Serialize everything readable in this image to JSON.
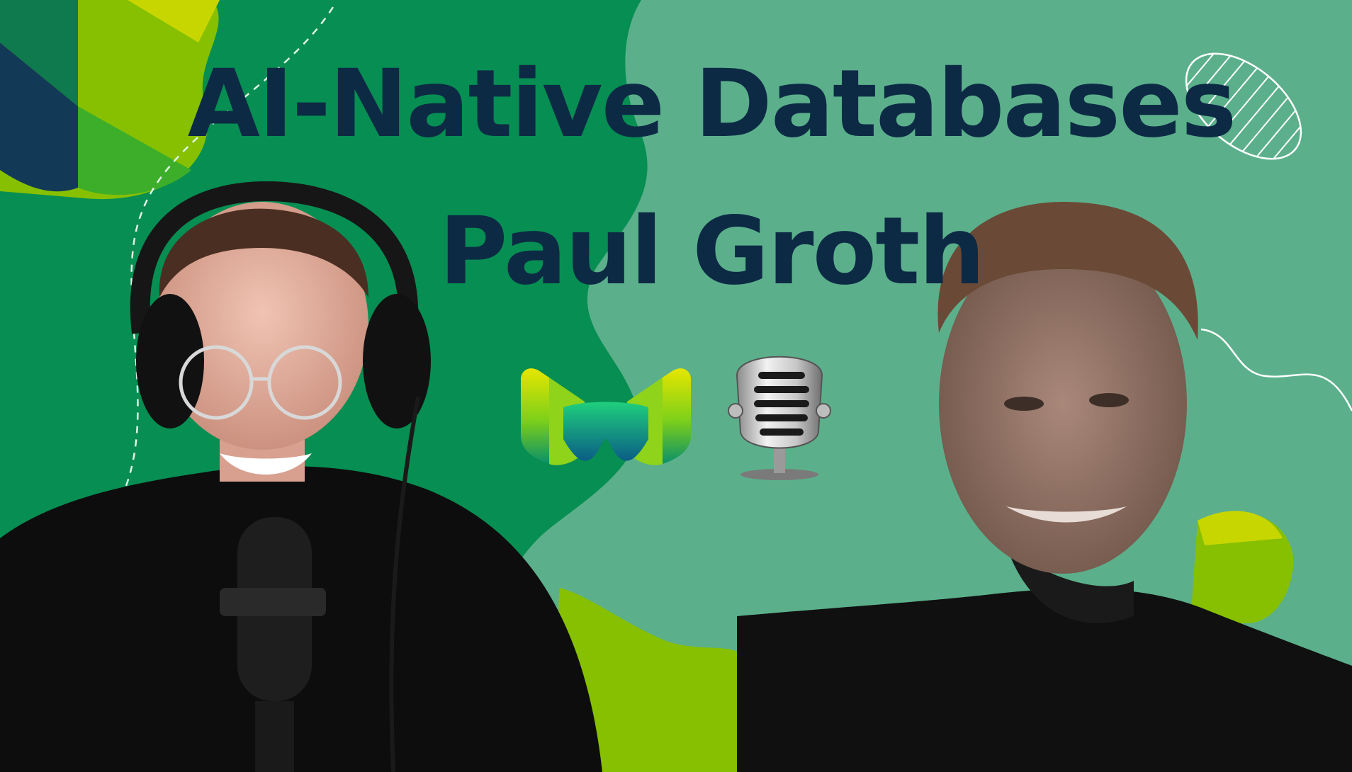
{
  "thumbnail": {
    "title_line1": "AI-Native Databases",
    "title_line2": "Paul Groth"
  },
  "colors": {
    "background_light": "#5bb08b",
    "background_dark": "#078e52",
    "title_text": "#0d2a45",
    "accent_lime": "#86c000",
    "accent_yellow": "#d7e100",
    "accent_navy": "#123a57"
  },
  "icons": {
    "logo": "weaviate-logo-icon",
    "microphone": "microphone-icon"
  }
}
